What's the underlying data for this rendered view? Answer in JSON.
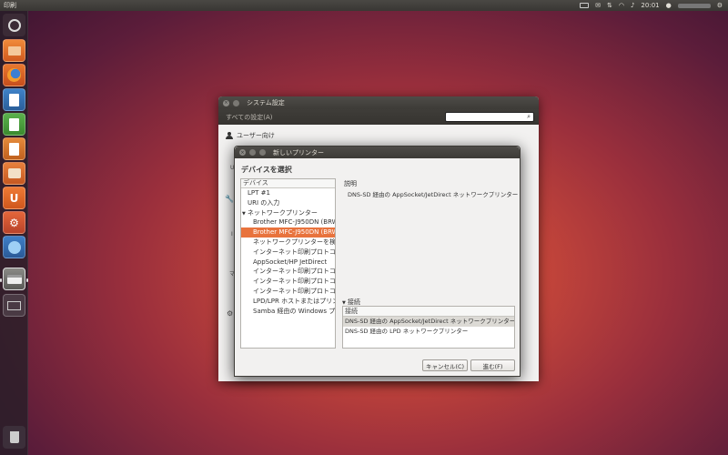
{
  "top_panel": {
    "app_title": "印刷",
    "clock": "20:01"
  },
  "launcher": {
    "items": [
      {
        "name": "dash-icon"
      },
      {
        "name": "files-icon"
      },
      {
        "name": "firefox-icon"
      },
      {
        "name": "writer-icon"
      },
      {
        "name": "calc-icon"
      },
      {
        "name": "impress-icon"
      },
      {
        "name": "software-center-icon"
      },
      {
        "name": "ubuntu-one-icon"
      },
      {
        "name": "system-settings-icon"
      },
      {
        "name": "workspaces-icon"
      },
      {
        "name": "printer-icon"
      },
      {
        "name": "workspace-switcher-icon"
      },
      {
        "name": "trash-icon"
      }
    ]
  },
  "settings_window": {
    "title": "システム設定",
    "all_settings": "すべての設定(A)",
    "section_user": "ユーザー向け"
  },
  "dialog": {
    "title": "新しいプリンター",
    "heading": "デバイスを選択",
    "device_header": "デバイス",
    "devices": [
      {
        "label": "LPT #1",
        "type": "item"
      },
      {
        "label": "URI の入力",
        "type": "item"
      },
      {
        "label": "ネットワークプリンター",
        "type": "group"
      },
      {
        "label": "Brother MFC-J950DN (BRW9C",
        "type": "sub"
      },
      {
        "label": "Brother MFC-J950DN (BRW0C",
        "type": "sub-selected"
      },
      {
        "label": "ネットワークプリンターを検索",
        "type": "sub"
      },
      {
        "label": "インターネット印刷プロトコル (i",
        "type": "sub"
      },
      {
        "label": "AppSocket/HP JetDirect",
        "type": "sub"
      },
      {
        "label": "インターネット印刷プロトコル (i",
        "type": "sub"
      },
      {
        "label": "インターネット印刷プロトコル (i",
        "type": "sub"
      },
      {
        "label": "インターネット印刷プロトコル (i",
        "type": "sub"
      },
      {
        "label": "LPD/LPR ホストまたはプリンタ",
        "type": "sub"
      },
      {
        "label": "Samba 経由の Windows プリ",
        "type": "sub"
      }
    ],
    "description_label": "説明",
    "description_text": "DNS-SD 経由の AppSocket/JetDirect ネットワークプリンター",
    "connection_label": "接続",
    "connection_header": "接続",
    "connections": [
      "DNS-SD 経由の AppSocket/JetDirect ネットワークプリンター",
      "DNS-SD 経由の LPD ネットワークプリンター"
    ],
    "cancel_label": "キャンセル(C)",
    "forward_label": "進む(F)"
  }
}
